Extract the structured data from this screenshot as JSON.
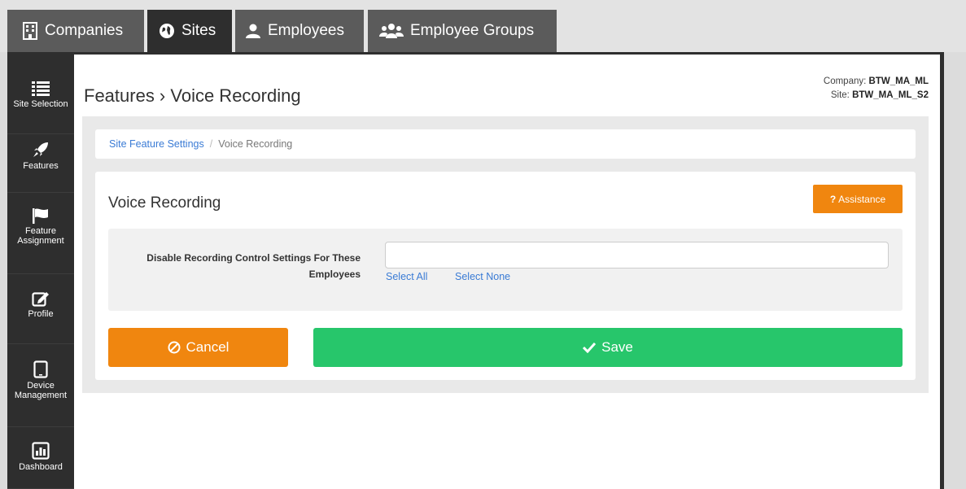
{
  "tabs": [
    {
      "label": "Companies",
      "icon": "building-icon",
      "active": false
    },
    {
      "label": "Sites",
      "icon": "globe-icon",
      "active": true
    },
    {
      "label": "Employees",
      "icon": "user-icon",
      "active": false
    },
    {
      "label": "Employee Groups",
      "icon": "users-icon",
      "active": false
    }
  ],
  "sidebar": {
    "items": [
      {
        "label": "Site Selection",
        "icon": "list-icon"
      },
      {
        "label": "Features",
        "icon": "rocket-icon",
        "active": true
      },
      {
        "label": "Feature Assignment",
        "icon": "flag-icon"
      },
      {
        "label": "Profile",
        "icon": "edit-icon"
      },
      {
        "label": "Device Management",
        "icon": "tablet-icon"
      },
      {
        "label": "Dashboard",
        "icon": "bar-chart-icon"
      }
    ]
  },
  "header": {
    "title": "Features › Voice Recording",
    "company_label": "Company:",
    "company_value": "BTW_MA_ML",
    "site_label": "Site:",
    "site_value": "BTW_MA_ML_S2"
  },
  "breadcrumb": {
    "parent": "Site Feature Settings",
    "separator": "/",
    "current": "Voice Recording"
  },
  "card": {
    "title": "Voice Recording",
    "assistance_label": "Assistance",
    "assistance_icon": "?"
  },
  "form": {
    "field_label": "Disable Recording Control Settings For These Employees",
    "field_value": "",
    "select_all": "Select All",
    "select_none": "Select None"
  },
  "actions": {
    "cancel_label": "Cancel",
    "save_label": "Save"
  },
  "colors": {
    "orange": "#f0860f",
    "green": "#27c66b",
    "link": "#3a7bd5",
    "dark": "#2e2e2e"
  }
}
